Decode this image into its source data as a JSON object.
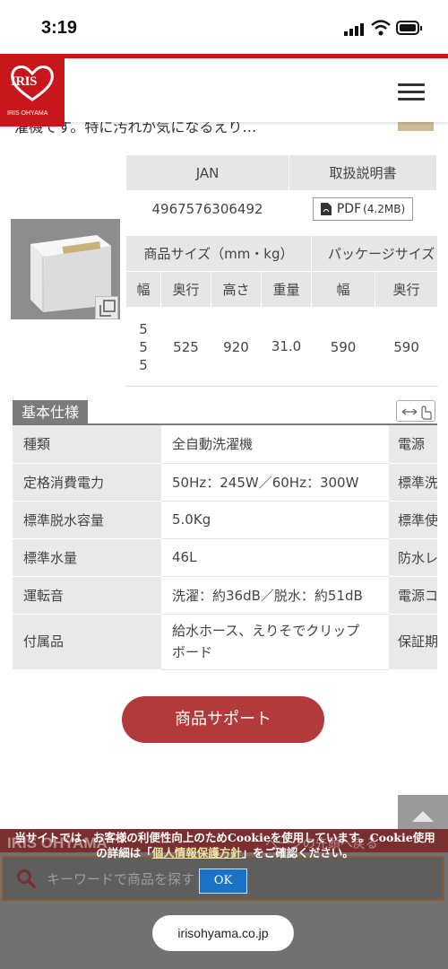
{
  "status_bar": {
    "time": "3:19"
  },
  "header": {
    "logo_text": "IRIS",
    "logo_sub": "IRIS OHYAMA"
  },
  "cutoff_text": "濯機です。特に汚れが気になるえり…",
  "jan_table": {
    "jan_header": "JAN",
    "manual_header": "取扱説明書",
    "jan_value": "4967576306492",
    "pdf_label": "PDF",
    "pdf_size": "(4.2MB)"
  },
  "size_table": {
    "product_size_header": "商品サイズ（mm・kg）",
    "package_size_header": "パッケージサイズ",
    "cols": [
      "幅",
      "奥行",
      "高さ",
      "重量",
      "幅",
      "奥行"
    ],
    "width_digits": [
      "5",
      "5",
      "5"
    ],
    "values": [
      "525",
      "920",
      "31.0",
      "590",
      "590"
    ]
  },
  "spec": {
    "title": "基本仕様",
    "rows": [
      {
        "key": "種類",
        "value": "全自動洗濯機",
        "key2": "電源"
      },
      {
        "key": "定格消費電力",
        "value": "50Hz：245W／60Hz：300W",
        "key2": "標準洗"
      },
      {
        "key": "標準脱水容量",
        "value": "5.0Kg",
        "key2": "標準使"
      },
      {
        "key": "標準水量",
        "value": "46L",
        "key2": "防水レ"
      },
      {
        "key": "運転音",
        "value": "洗濯：約36dB／脱水：約51dB",
        "key2": "電源コ"
      },
      {
        "key": "付属品",
        "value_line1": "給水ホース、えりそでクリップ",
        "value_line2": "ボード",
        "key2": "保証期"
      }
    ]
  },
  "support_button": "商品サポート",
  "footer": {
    "logo": "IRIS OHYAMA",
    "pagetop_text": "ページの先頭へ戻る",
    "search_placeholder": "キーワードで商品を探す"
  },
  "cookie": {
    "line1": "当サイトでは、お客様の利便性向上のためCookieを使用しています。Cookie使用",
    "line2_pre": "の詳細は「",
    "line2_link": "個人情報保護方針",
    "line2_post": "」をご確認ください。",
    "ok": "OK"
  },
  "url": "irisohyama.co.jp"
}
